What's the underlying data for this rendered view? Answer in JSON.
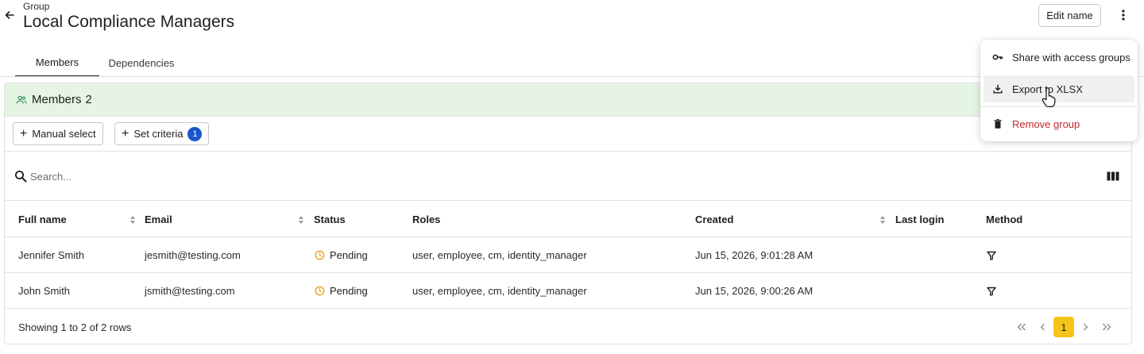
{
  "header": {
    "eyebrow": "Group",
    "title": "Local Compliance Managers",
    "edit_label": "Edit name"
  },
  "tabs": [
    {
      "label": "Members",
      "active": true
    },
    {
      "label": "Dependencies",
      "active": false
    }
  ],
  "members": {
    "heading": "Members",
    "count": "2",
    "manual_select_label": "Manual select",
    "set_criteria_label": "Set criteria",
    "criteria_badge": "1",
    "search_placeholder": "Search..."
  },
  "table": {
    "columns": [
      "Full name",
      "Email",
      "Status",
      "Roles",
      "Created",
      "Last login",
      "Method"
    ],
    "rows": [
      {
        "full_name": "Jennifer Smith",
        "email": "jesmith@testing.com",
        "status": "Pending",
        "roles": "user, employee, cm, identity_manager",
        "created": "Jun 15, 2026, 9:01:28 AM",
        "last_login": "",
        "method": "filter-icon"
      },
      {
        "full_name": "John Smith",
        "email": "jsmith@testing.com",
        "status": "Pending",
        "roles": "user, employee, cm, identity_manager",
        "created": "Jun 15, 2026, 9:00:26 AM",
        "last_login": "",
        "method": "filter-icon"
      }
    ],
    "footer_info": "Showing 1 to 2 of 2 rows",
    "current_page": "1"
  },
  "menu": {
    "items": [
      {
        "label": "Share with access groups",
        "icon": "key-icon"
      },
      {
        "label": "Export to XLSX",
        "icon": "download-icon"
      },
      {
        "label": "Remove group",
        "icon": "trash-icon"
      }
    ]
  },
  "colors": {
    "members_header_bg": "#e5f4e3",
    "badge": "#1a56c8",
    "current_page": "#f5c518",
    "danger": "#c0282b",
    "pending": "#e8a317"
  }
}
